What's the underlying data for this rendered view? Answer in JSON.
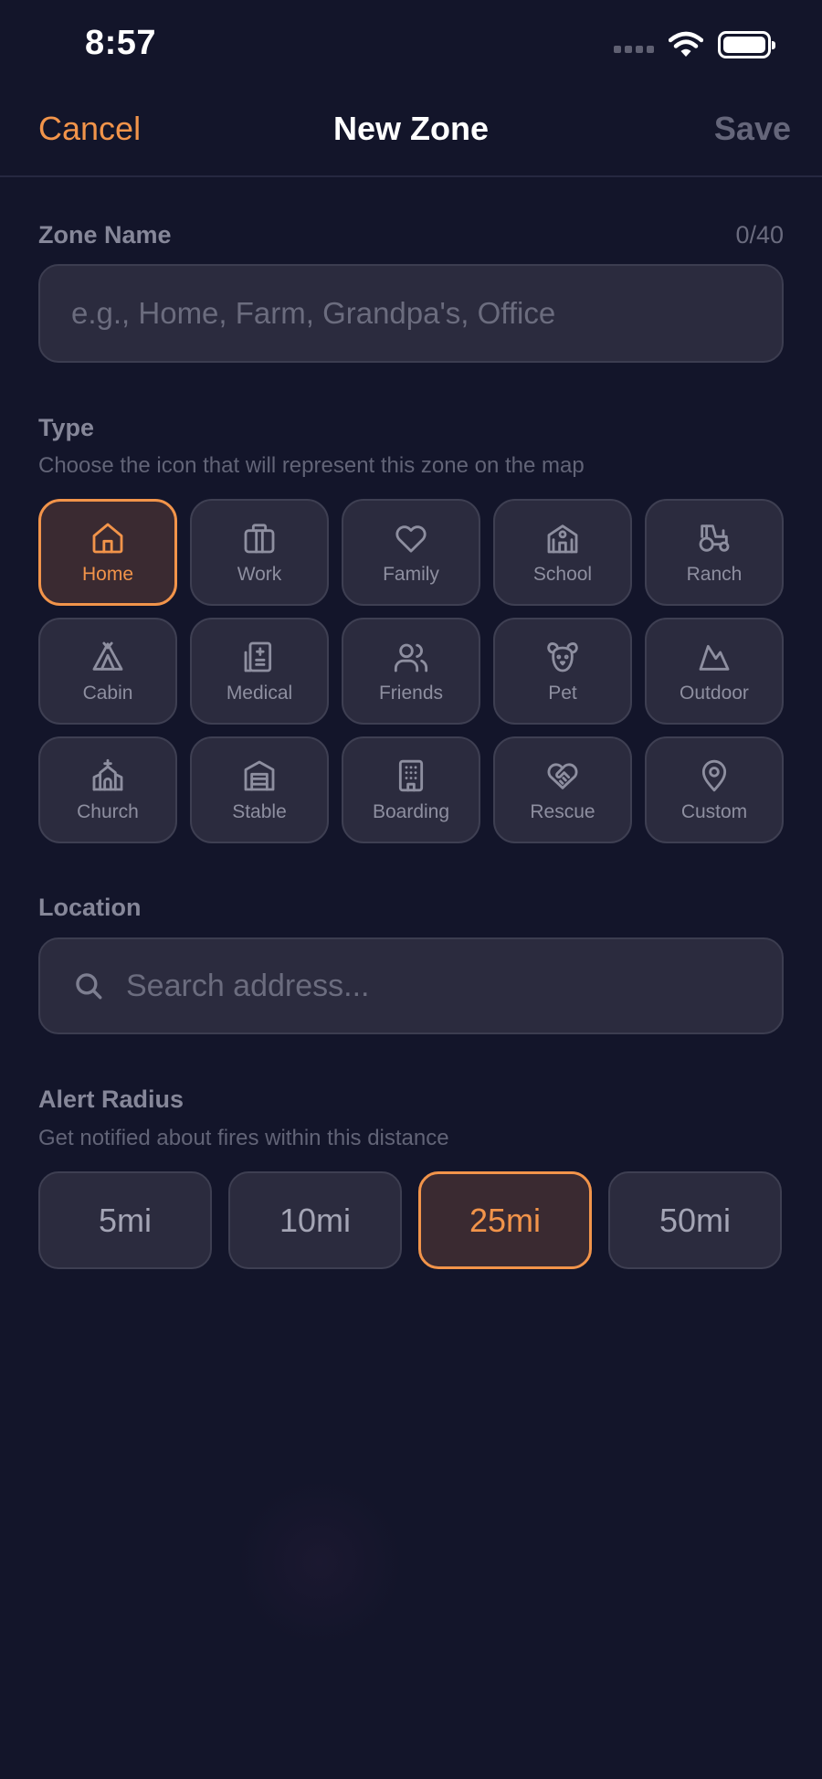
{
  "status": {
    "time": "8:57"
  },
  "nav": {
    "cancel": "Cancel",
    "title": "New Zone",
    "save": "Save"
  },
  "zone_name": {
    "label": "Zone Name",
    "count": "0/40",
    "value": "",
    "placeholder": "e.g., Home, Farm, Grandpa's, Office"
  },
  "type": {
    "label": "Type",
    "subtitle": "Choose the icon that will represent this zone on the map",
    "selected": "Home",
    "items": [
      {
        "label": "Home",
        "icon": "home-icon"
      },
      {
        "label": "Work",
        "icon": "briefcase-icon"
      },
      {
        "label": "Family",
        "icon": "heart-icon"
      },
      {
        "label": "School",
        "icon": "school-icon"
      },
      {
        "label": "Ranch",
        "icon": "tractor-icon"
      },
      {
        "label": "Cabin",
        "icon": "tent-icon"
      },
      {
        "label": "Medical",
        "icon": "medical-icon"
      },
      {
        "label": "Friends",
        "icon": "users-icon"
      },
      {
        "label": "Pet",
        "icon": "dog-icon"
      },
      {
        "label": "Outdoor",
        "icon": "mountain-icon"
      },
      {
        "label": "Church",
        "icon": "church-icon"
      },
      {
        "label": "Stable",
        "icon": "warehouse-icon"
      },
      {
        "label": "Boarding",
        "icon": "building-icon"
      },
      {
        "label": "Rescue",
        "icon": "heart-handshake-icon"
      },
      {
        "label": "Custom",
        "icon": "map-pin-icon"
      }
    ]
  },
  "location": {
    "label": "Location",
    "placeholder": "Search address..."
  },
  "alert_radius": {
    "label": "Alert Radius",
    "subtitle": "Get notified about fires within this distance",
    "selected": "25mi",
    "options": [
      "5mi",
      "10mi",
      "25mi",
      "50mi"
    ]
  },
  "colors": {
    "accent": "#f2944a",
    "background": "#13152a",
    "surface": "#2b2b3e"
  }
}
